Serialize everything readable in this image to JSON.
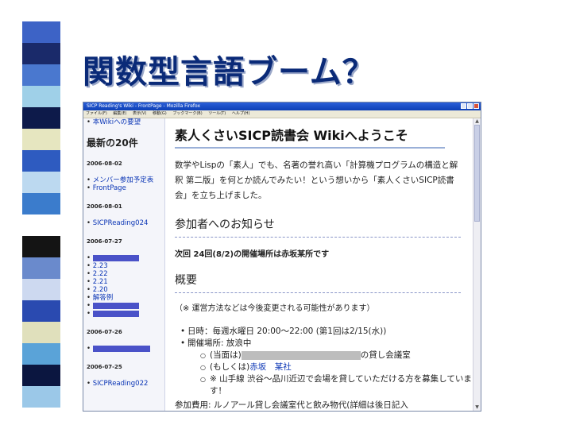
{
  "slide": {
    "title": "関数型言語ブーム？"
  },
  "stripe_colors": [
    "#ffffff",
    "#3d63c6",
    "#1a2a6a",
    "#4a78cf",
    "#9fd0e8",
    "#0d1a4a",
    "#e6e6c0",
    "#2e5bc0",
    "#bcd9f0",
    "#3b7ccc",
    "#ffffff",
    "#141414",
    "#6a8acc",
    "#cdd9f0",
    "#2a4ab0",
    "#e0e0bc",
    "#5aa3d8",
    "#0b1640",
    "#9bc8e8",
    "#ffffff"
  ],
  "browser": {
    "title": "SICP Reading's Wiki - FrontPage - Mozilla Firefox",
    "menu": [
      "ファイル(F)",
      "編集(E)",
      "表示(V)",
      "移動(G)",
      "ブックマーク(B)",
      "ツール(T)",
      "ヘルプ(H)"
    ]
  },
  "sidebar": {
    "top_link": "本Wikiへの要望",
    "heading": "最新の20件",
    "groups": [
      {
        "date": "2006-08-02",
        "items": [
          "メンバー参加予定表",
          "FrontPage"
        ]
      },
      {
        "date": "2006-08-01",
        "items": [
          "SICPReading024"
        ]
      },
      {
        "date": "2006-07-27",
        "items": [
          "",
          "2.23",
          "2.22",
          "2.21",
          "2.20",
          "解答例",
          "",
          ""
        ]
      },
      {
        "date": "2006-07-26",
        "items": [
          ""
        ]
      },
      {
        "date": "2006-07-25",
        "items": [
          "SICPReading022"
        ]
      }
    ]
  },
  "main": {
    "title": "素人くさいSICP読書会 Wikiへようこそ",
    "intro": "数学やLispの「素人」でも、名著の誉れ高い「計算機プログラムの構造と解釈 第二版」を何とか読んでみたい！という想いから「素人くさいSICP読書会」を立ち上げました。",
    "section1": "参加者へのお知らせ",
    "notice": "次回 24回(8/2)の開催場所は赤坂某所です",
    "section2": "概要",
    "note": "（※ 運営方法などは今後変更される可能性があります）",
    "schedule": "日時：毎週水曜日 20:00〜22:00 (第1回は2/15(水))",
    "place": "開催場所: 放浪中",
    "place_current_prefix": "(当面は)",
    "place_current_suffix": "の貸し会議室",
    "place_or_prefix": "(もしくは)",
    "place_or_link": "赤坂　某社",
    "place_note": "※ 山手線 渋谷〜品川近辺で会場を貸していただける方を募集しています！",
    "cut_text": "参加費用: ルノアール貸し会議室代と飲み物代(詳細は後日記入"
  }
}
